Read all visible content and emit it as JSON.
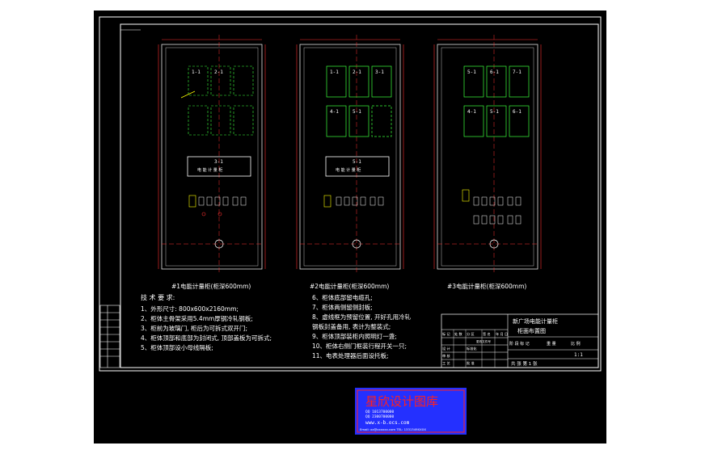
{
  "drawing": {
    "cabinet_titles": [
      "#1电能计量柜(柜深600mm)",
      "#2电能计量柜(柜深600mm)",
      "#3电能计量柜(柜深600mm)"
    ],
    "cabinets": [
      {
        "meter_labels": [
          "1-1",
          "2-1"
        ],
        "lower_meter_labels": [],
        "panel_label": "3-1",
        "panel_text": "电 能 计 量 柜",
        "grid": "dashed"
      },
      {
        "meter_labels": [
          "1-1",
          "2-1",
          "3-1"
        ],
        "lower_meter_labels": [
          "4-1",
          "5-1"
        ],
        "panel_label": "5-1",
        "panel_text": "电 能 计 量 柜",
        "grid": "solid"
      },
      {
        "meter_labels": [
          "5-1",
          "6-1",
          "7-1"
        ],
        "lower_meter_labels": [
          "4-1",
          "5-1",
          "6-1"
        ],
        "panel_label": "",
        "panel_text": "",
        "grid": "solid"
      }
    ],
    "tech_requirements": {
      "heading": "技 术 要 求:",
      "left": [
        "1、外形尺寸: 800x600x2160mm;",
        "2、柜体主骨架采用5.4mm厚钢冷轧钢板;",
        "3、柜前为玻璃门, 柜后为可拆式双开门;",
        "4、柜体顶部和底部为封闭式, 顶部盖板为可拆式;",
        "5、柜体顶部设小母线隔板;"
      ],
      "right": [
        "6、柜体底部留电缆孔;",
        "7、柜体两侧留侧封板;",
        "8、虚线框为预留位置, 开好孔用冷轧",
        "   钢板封盖备用, 表计为整装式;",
        "9、柜体顶部装柜内照明灯一盏;",
        "10、柜体右侧门框装行程开关一只;",
        "11、电表处理器后面设托板;"
      ]
    },
    "title_block": {
      "name_line1": "新广场电能计量柜",
      "name_line2": "柜面布置图",
      "cells": [
        "标 记",
        "处 数",
        "分 区",
        "更改文件号",
        "签 名",
        "年 月 日",
        "设 计",
        "标准化",
        "审 核",
        "工 艺",
        "批 准"
      ],
      "stage_labels": [
        "阶 段 标 记",
        "重 量",
        "比 例"
      ],
      "sheet": "共 张  第 1 张",
      "ratio": "1:1"
    },
    "watermark": {
      "title": "星欣设计图库",
      "lines": [
        "QQ 1013700000",
        "QQ 2300700000",
        "www.x-b.ocs.com",
        "Email: xx@xxxxxx.com  TEL: 1331349XXXX"
      ]
    }
  },
  "colors": {
    "background": "#000000",
    "frame": "#ffffff",
    "outline": "#e0e0e0",
    "dim_red": "#ff3030",
    "meter_green": "#3cff3c",
    "terminal_yellow": "#ffff00",
    "watermark_blue": "#2430ff",
    "watermark_red": "#ff2020"
  }
}
